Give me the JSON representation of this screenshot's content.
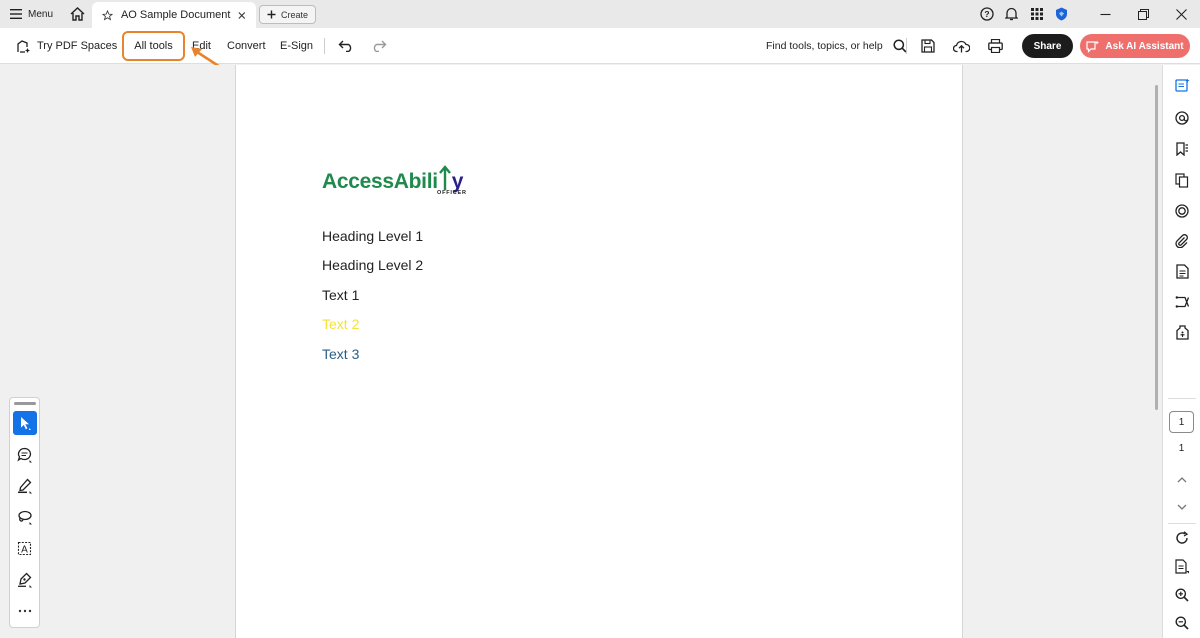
{
  "titlebar": {
    "menu_label": "Menu",
    "tab_title": "AO Sample Document",
    "create_label": "Create"
  },
  "toolbar": {
    "try_spaces_label": "Try PDF Spaces",
    "all_tools_label": "All tools",
    "edit_label": "Edit",
    "convert_label": "Convert",
    "esign_label": "E-Sign",
    "find_label": "Find tools, topics, or help",
    "share_label": "Share",
    "ai_label": "Ask AI Assistant"
  },
  "document": {
    "logo_main_a": "AccessAbili",
    "logo_main_b": "y",
    "logo_sub": "OFFICER",
    "lines": [
      {
        "text": "Heading Level 1",
        "color": "#222222"
      },
      {
        "text": "Heading Level 2",
        "color": "#222222"
      },
      {
        "text": "Text 1",
        "color": "#222222"
      },
      {
        "text": "Text 2",
        "color": "#f5e23a"
      },
      {
        "text": "Text 3",
        "color": "#2b5f86"
      }
    ]
  },
  "page_nav": {
    "current": "1",
    "total": "1"
  },
  "colors": {
    "highlight": "#e8842e",
    "accent": "#1473e6",
    "ai_button": "#ef6f6c",
    "share_button": "#1c1c1c"
  },
  "icons": {
    "titlebar": [
      "hamburger-icon",
      "home-icon",
      "star-icon",
      "close-icon",
      "plus-icon",
      "help-icon",
      "bell-icon",
      "apps-grid-icon",
      "shield-icon"
    ],
    "toolbar": [
      "spaces-icon",
      "undo-icon",
      "redo-icon",
      "search-icon",
      "save-icon",
      "upload-icon",
      "print-icon",
      "ai-assistant-icon"
    ],
    "right_panel": [
      "comments-panel-icon",
      "at-icon",
      "bookmark-icon",
      "pages-icon",
      "layers-icon",
      "attachment-icon",
      "document-icon",
      "compare-icon",
      "accessibility-icon",
      "chevron-up-icon",
      "chevron-down-icon",
      "rotate-icon",
      "page-fit-icon",
      "zoom-in-icon",
      "zoom-out-icon"
    ],
    "left_tools": [
      "select-icon",
      "comment-icon",
      "highlight-pen-icon",
      "lasso-icon",
      "text-box-icon",
      "sign-icon",
      "more-icon"
    ]
  }
}
